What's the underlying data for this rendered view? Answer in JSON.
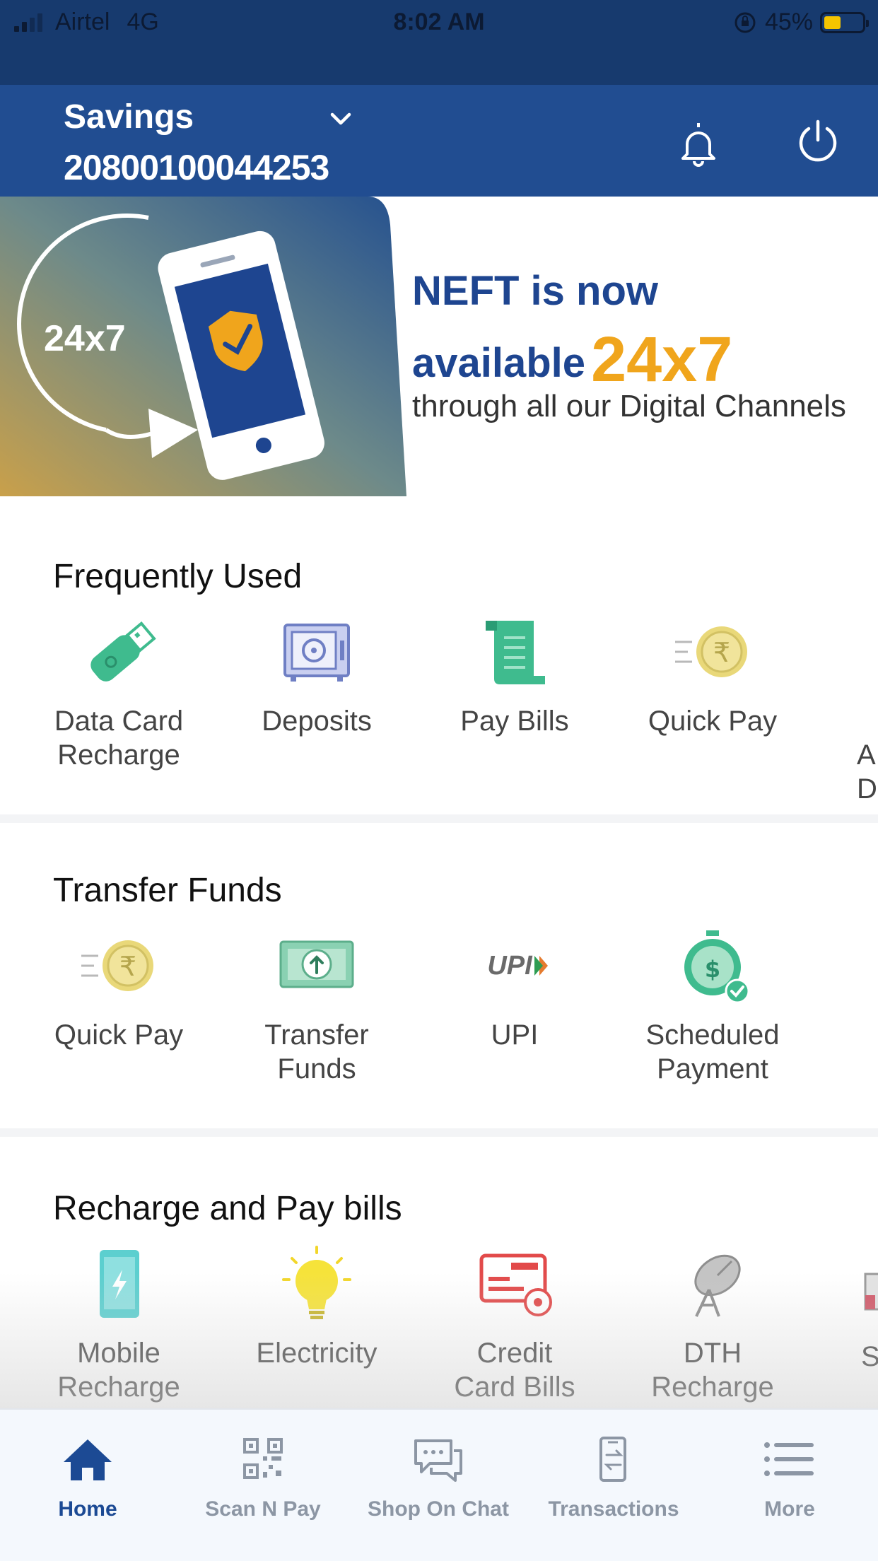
{
  "status_bar": {
    "carrier": "Airtel",
    "network": "4G",
    "time": "8:02 AM",
    "battery_text": "45%",
    "battery_level": 0.45
  },
  "header": {
    "account_type": "Savings",
    "account_number": "20800100044253"
  },
  "banner": {
    "line1": "NEFT is now",
    "line2": "available",
    "highlight": "24x7",
    "line3": "through all our Digital Channels",
    "badge": "24x7"
  },
  "frequently_used": {
    "title": "Frequently Used",
    "items": [
      {
        "label_1": "Data Card",
        "label_2": "Recharge",
        "icon": "usb-stick-icon"
      },
      {
        "label_1": "Deposits",
        "label_2": "",
        "icon": "safe-icon"
      },
      {
        "label_1": "Pay Bills",
        "label_2": "",
        "icon": "bill-scroll-icon"
      },
      {
        "label_1": "Quick Pay",
        "label_2": "",
        "icon": "rupee-coin-icon"
      },
      {
        "label_1": "A",
        "label_2": "D",
        "icon": ""
      }
    ]
  },
  "transfer_funds": {
    "title": "Transfer Funds",
    "items": [
      {
        "label_1": "Quick Pay",
        "label_2": "",
        "icon": "rupee-coin-icon"
      },
      {
        "label_1": "Transfer",
        "label_2": "Funds",
        "icon": "banknote-icon"
      },
      {
        "label_1": "UPI",
        "label_2": "",
        "icon": "upi-logo-icon",
        "logo_text": "UPI"
      },
      {
        "label_1": "Scheduled",
        "label_2": "Payment",
        "icon": "stopwatch-icon"
      }
    ]
  },
  "recharge_bills": {
    "title": "Recharge and Pay bills",
    "items": [
      {
        "label_1": "Mobile",
        "label_2": "Recharge",
        "icon": "mobile-icon"
      },
      {
        "label_1": "Electricity",
        "label_2": "",
        "icon": "bulb-icon"
      },
      {
        "label_1": "Credit",
        "label_2": "Card Bills",
        "icon": "credit-card-icon"
      },
      {
        "label_1": "DTH",
        "label_2": "Recharge",
        "icon": "satellite-dish-icon"
      },
      {
        "label_1": "S",
        "label_2": "",
        "icon": ""
      }
    ]
  },
  "tabbar": {
    "tabs": [
      {
        "label": "Home",
        "icon": "home-icon",
        "active": true
      },
      {
        "label": "Scan N Pay",
        "icon": "qr-code-icon",
        "active": false
      },
      {
        "label": "Shop On Chat",
        "icon": "chat-icon",
        "active": false
      },
      {
        "label": "Transactions",
        "icon": "transactions-icon",
        "active": false
      },
      {
        "label": "More",
        "icon": "menu-icon",
        "active": false
      }
    ]
  },
  "colors": {
    "header_blue": "#214d91",
    "status_blue": "#173a6e",
    "accent_yellow": "#f0a51c",
    "active_tab": "#1c4a94",
    "inactive_tab": "#8c96a4"
  }
}
